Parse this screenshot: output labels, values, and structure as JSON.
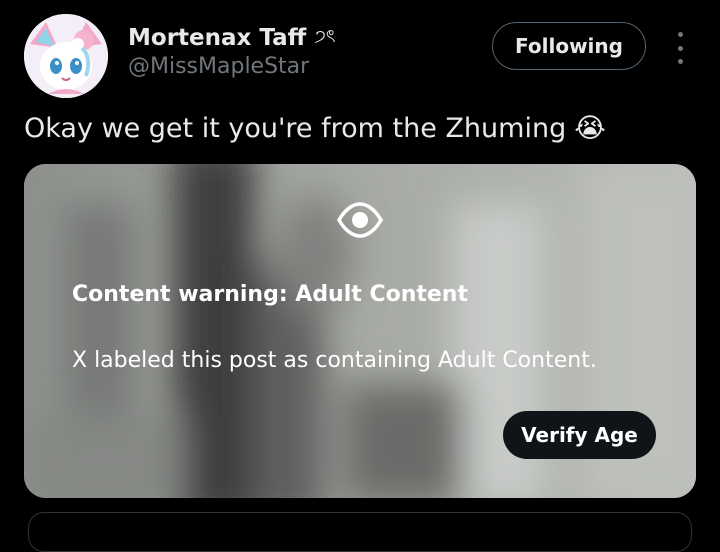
{
  "post": {
    "author": {
      "display_name": "Mortenax Taff",
      "name_emoji": "੭ৎ",
      "handle": "@MissMapleStar",
      "avatar_icon": "sylveon-avatar"
    },
    "follow_button_label": "Following",
    "more_icon": "more-vertical-icon",
    "text": "Okay we get it you're from the Zhuming",
    "text_emoji": "😭"
  },
  "media": {
    "eye_icon": "eye-icon",
    "warning_title": "Content warning: Adult Content",
    "warning_description": "X labeled this post as containing Adult Content.",
    "verify_button_label": "Verify Age"
  },
  "colors": {
    "background": "#000000",
    "primary_text": "#e7e9ea",
    "secondary_text": "#71767b",
    "border": "#536471",
    "verify_button_bg": "#0f1419"
  }
}
